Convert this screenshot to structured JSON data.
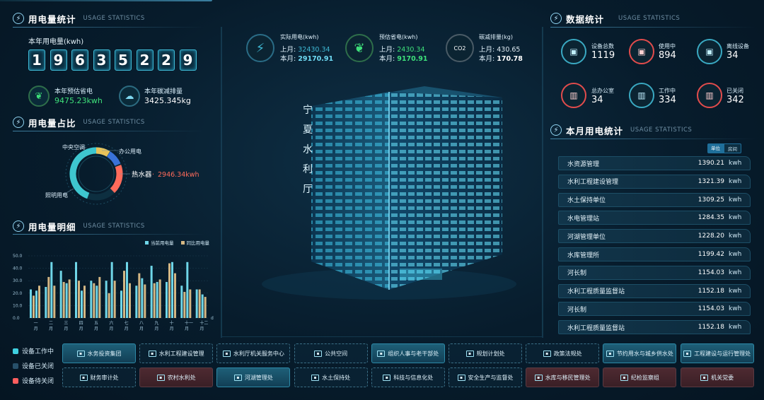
{
  "colors": {
    "accent": "#3fd0e0",
    "saving": "#3ee07a",
    "hot": "#ff6b5b",
    "bar_current": "#6fd6e8",
    "bar_compare": "#d4b784",
    "power": "#3fb9d4",
    "alert": "#ff5e5e"
  },
  "left": {
    "usage_stats": {
      "title": "用电量统计",
      "sub": "USAGE STATISTICS",
      "year_label": "本年用电量(kwh)",
      "digits": [
        "1",
        "9",
        "6",
        "3",
        "5",
        "2",
        "2",
        "9"
      ],
      "saving_label": "本年预估省电",
      "saving_value": "9475.23kwh",
      "carbon_label": "本年碳减排量",
      "carbon_value": "3425.345kg"
    },
    "ratio": {
      "title": "用电量占比",
      "sub": "USAGE STATISTICS",
      "labels": [
        "中央空调",
        "办公用电",
        "热水器",
        "照明用电"
      ],
      "highlight_value": "2946.34kwh",
      "highlight_sep": "·"
    },
    "detail": {
      "title": "用电量明细",
      "sub": "USAGE STATISTICS",
      "legend_current": "当前用电量",
      "legend_compare": "同比用电量",
      "unit": "d"
    }
  },
  "chart_data": {
    "type": "bar",
    "title": "",
    "xlabel": "",
    "ylabel": "",
    "ylim": [
      0,
      50
    ],
    "yticks": [
      "0.0",
      "10.0",
      "20.0",
      "30.0",
      "40.0",
      "50.0"
    ],
    "categories": [
      "一月",
      "二月",
      "三月",
      "四月",
      "五月",
      "六月",
      "七月",
      "八月",
      "九月",
      "十月",
      "十一月",
      "十二月"
    ],
    "series": [
      {
        "name": "当前用电量",
        "values": [
          [
            23,
            22
          ],
          [
            25,
            45
          ],
          [
            38,
            28
          ],
          [
            45,
            22
          ],
          [
            30,
            26
          ],
          [
            30,
            45
          ],
          [
            22,
            45
          ],
          [
            26,
            32
          ],
          [
            42,
            29
          ],
          [
            29,
            45
          ],
          [
            26,
            45
          ],
          [
            23,
            19
          ]
        ]
      },
      {
        "name": "同比用电量",
        "values": [
          [
            18,
            26
          ],
          [
            33,
            26
          ],
          [
            29,
            31
          ],
          [
            30,
            26
          ],
          [
            28,
            33
          ],
          [
            20,
            30
          ],
          [
            38,
            28
          ],
          [
            36,
            27
          ],
          [
            28,
            31
          ],
          [
            44,
            36
          ],
          [
            21,
            23
          ],
          [
            23,
            17
          ]
        ]
      }
    ]
  },
  "top": {
    "actual": {
      "title": "实际用电(kwh)",
      "last_label": "上月:",
      "last": "32430.34",
      "this_label": "本月:",
      "this": "29170.91"
    },
    "saved": {
      "title": "预估省电(kwh)",
      "last_label": "上月:",
      "last": "2430.34",
      "this_label": "本月:",
      "this": "9170.91"
    },
    "carbon": {
      "title": "碳减排量(kg)",
      "last_label": "上月:",
      "last": "430.65",
      "this_label": "本月:",
      "this": "170.78",
      "icon_text": "CO2"
    }
  },
  "building": {
    "sign": [
      "宁",
      "夏",
      "水",
      "利",
      "厅"
    ]
  },
  "right": {
    "data_stats": {
      "title": "数据统计",
      "sub": "USAGE STATISTICS",
      "items": [
        {
          "label": "设备总数",
          "value": "1119"
        },
        {
          "label": "使用中",
          "value": "894"
        },
        {
          "label": "离线设备",
          "value": "34"
        },
        {
          "label": "总办公室",
          "value": "34"
        },
        {
          "label": "工作中",
          "value": "334"
        },
        {
          "label": "已关闭",
          "value": "342"
        }
      ]
    },
    "month": {
      "title": "本月用电统计",
      "sub": "USAGE STATISTICS",
      "toggle": [
        "单位",
        "房间"
      ],
      "unit": "kwh",
      "rows": [
        {
          "name": "水资源管理",
          "value": "1390.21"
        },
        {
          "name": "水利工程建设管理",
          "value": "1321.39"
        },
        {
          "name": "水土保持单位",
          "value": "1309.25"
        },
        {
          "name": "水电管理站",
          "value": "1284.35"
        },
        {
          "name": "河湖管理单位",
          "value": "1228.20"
        },
        {
          "name": "水库管理所",
          "value": "1199.42"
        },
        {
          "name": "河长制",
          "value": "1154.03"
        },
        {
          "name": "水利工程质量监督站",
          "value": "1152.18"
        },
        {
          "name": "河长制",
          "value": "1154.03"
        },
        {
          "name": "水利工程质量监督站",
          "value": "1152.18"
        }
      ]
    }
  },
  "bottom": {
    "legend": [
      "设备工作中",
      "设备已关闭",
      "设备待关闭"
    ],
    "row1": [
      {
        "label": "水务投资集团",
        "state": "on"
      },
      {
        "label": "水利工程建设管理",
        "state": "idle"
      },
      {
        "label": "水利厅机关服务中心",
        "state": "idle"
      },
      {
        "label": "公共空间",
        "state": "idle"
      },
      {
        "label": "组织人事与老干部处",
        "state": "on"
      },
      {
        "label": "规划计划处",
        "state": "idle"
      },
      {
        "label": "政策法规处",
        "state": "idle"
      },
      {
        "label": "节约用水与城乡供水处",
        "state": "on"
      },
      {
        "label": "工程建设与运行管理处",
        "state": "on"
      }
    ],
    "row2": [
      {
        "label": "财务审计处",
        "state": "idle"
      },
      {
        "label": "农村水利处",
        "state": "off"
      },
      {
        "label": "河湖管理处",
        "state": "on"
      },
      {
        "label": "水土保持处",
        "state": "idle"
      },
      {
        "label": "科技与信息化处",
        "state": "idle"
      },
      {
        "label": "安全生产与监督处",
        "state": "idle"
      },
      {
        "label": "水库与移民管理处",
        "state": "off"
      },
      {
        "label": "纪检监察组",
        "state": "off"
      },
      {
        "label": "机关党委",
        "state": "off"
      }
    ]
  }
}
